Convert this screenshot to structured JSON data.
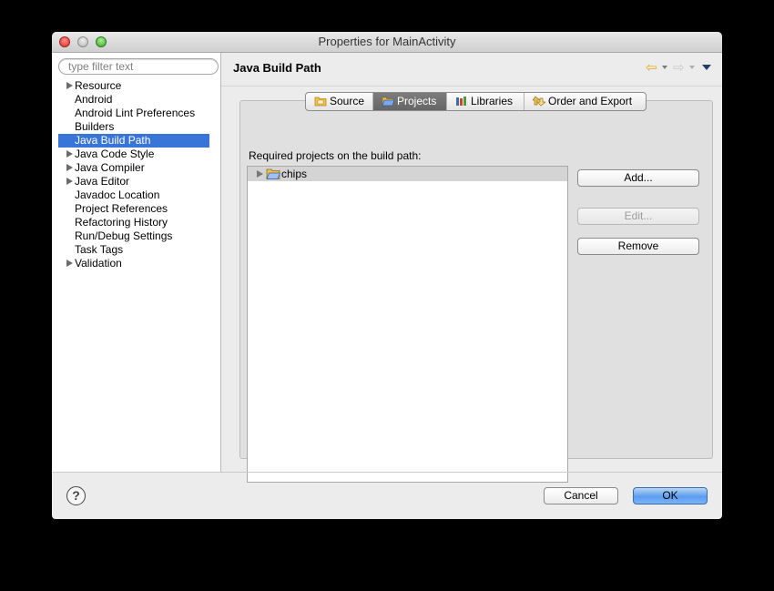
{
  "window": {
    "title": "Properties for MainActivity"
  },
  "sidebar": {
    "filter_placeholder": "type filter text",
    "items": [
      {
        "label": "Resource",
        "expandable": true
      },
      {
        "label": "Android",
        "expandable": false
      },
      {
        "label": "Android Lint Preferences",
        "expandable": false
      },
      {
        "label": "Builders",
        "expandable": false
      },
      {
        "label": "Java Build Path",
        "expandable": false,
        "selected": true
      },
      {
        "label": "Java Code Style",
        "expandable": true
      },
      {
        "label": "Java Compiler",
        "expandable": true
      },
      {
        "label": "Java Editor",
        "expandable": true
      },
      {
        "label": "Javadoc Location",
        "expandable": false
      },
      {
        "label": "Project References",
        "expandable": false
      },
      {
        "label": "Refactoring History",
        "expandable": false
      },
      {
        "label": "Run/Debug Settings",
        "expandable": false
      },
      {
        "label": "Task Tags",
        "expandable": false
      },
      {
        "label": "Validation",
        "expandable": true
      }
    ]
  },
  "main": {
    "title": "Java Build Path",
    "tabs": [
      {
        "label": "Source",
        "icon": "source-folder-icon"
      },
      {
        "label": "Projects",
        "icon": "projects-folder-icon",
        "active": true
      },
      {
        "label": "Libraries",
        "icon": "libraries-icon"
      },
      {
        "label": "Order and Export",
        "icon": "order-export-icon"
      }
    ],
    "required_label": "Required projects on the build path:",
    "projects": [
      {
        "name": "chips",
        "icon": "project-folder-icon"
      }
    ],
    "buttons": {
      "add": "Add...",
      "edit": "Edit...",
      "remove": "Remove"
    }
  },
  "footer": {
    "help_label": "?",
    "cancel": "Cancel",
    "ok": "OK"
  },
  "colors": {
    "selection": "#3875d7",
    "default_button": "#5a9cf0",
    "active_tab": "#6e6e6e"
  }
}
